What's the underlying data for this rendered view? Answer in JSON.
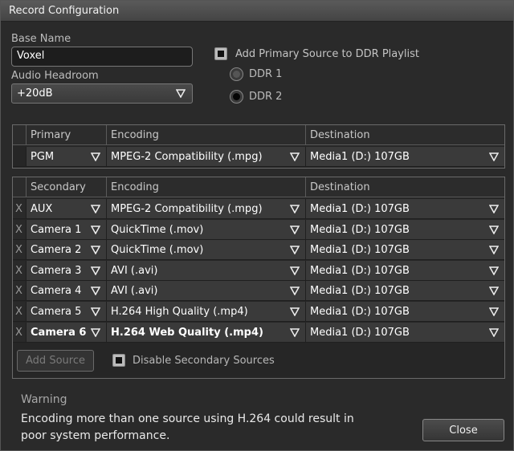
{
  "window": {
    "title": "Record Configuration"
  },
  "base_name": {
    "label": "Base Name",
    "value": "Voxel"
  },
  "audio_headroom": {
    "label": "Audio Headroom",
    "value": "+20dB"
  },
  "ddr": {
    "checkbox_label": "Add Primary Source to DDR Playlist",
    "options": [
      "DDR 1",
      "DDR 2"
    ],
    "selected": "DDR 2"
  },
  "primary_table": {
    "headers": [
      "Primary",
      "Encoding",
      "Destination"
    ],
    "rows": [
      {
        "source": "PGM",
        "encoding": "MPEG-2 Compatibility (.mpg)",
        "destination": "Media1 (D:) 107GB"
      }
    ]
  },
  "secondary_table": {
    "headers": [
      "Secondary",
      "Encoding",
      "Destination"
    ],
    "remove_label": "X",
    "rows": [
      {
        "source": "AUX",
        "encoding": "MPEG-2 Compatibility (.mpg)",
        "destination": "Media1 (D:) 107GB"
      },
      {
        "source": "Camera 1",
        "encoding": "QuickTime (.mov)",
        "destination": "Media1 (D:) 107GB"
      },
      {
        "source": "Camera 2",
        "encoding": "QuickTime (.mov)",
        "destination": "Media1 (D:) 107GB"
      },
      {
        "source": "Camera 3",
        "encoding": "AVI (.avi)",
        "destination": "Media1 (D:) 107GB"
      },
      {
        "source": "Camera 4",
        "encoding": "AVI (.avi)",
        "destination": "Media1 (D:) 107GB"
      },
      {
        "source": "Camera 5",
        "encoding": "H.264 High Quality (.mp4)",
        "destination": "Media1 (D:) 107GB"
      },
      {
        "source": "Camera 6",
        "encoding": "H.264 Web Quality (.mp4)",
        "destination": "Media1 (D:) 107GB"
      }
    ]
  },
  "add_source_label": "Add Source",
  "disable_secondary_label": "Disable Secondary Sources",
  "warning": {
    "title": "Warning",
    "text": "Encoding more than one source using H.264 could result in poor system performance."
  },
  "close_label": "Close",
  "icons": {
    "dropdown": "triangle-down-icon",
    "remove": "x-icon"
  }
}
